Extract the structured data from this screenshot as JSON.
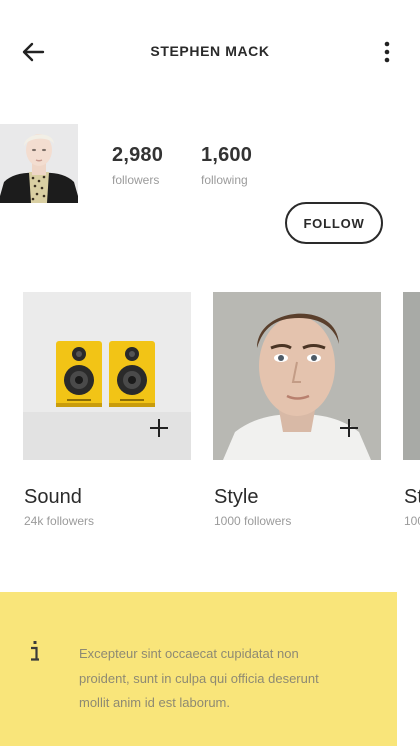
{
  "header": {
    "title": "STEPHEN MACK",
    "back_icon": "arrow-left-icon",
    "menu_icon": "more-vertical-icon"
  },
  "profile": {
    "followers_count": "2,980",
    "followers_label": "followers",
    "following_count": "1,600",
    "following_label": "following",
    "follow_button": "FOLLOW"
  },
  "cards": [
    {
      "title": "Sound",
      "subtitle": "24k followers",
      "image": "yellow-speakers",
      "action_icon": "plus-icon"
    },
    {
      "title": "Style",
      "subtitle": "1000 followers",
      "image": "portrait",
      "action_icon": "plus-icon"
    },
    {
      "title": "St",
      "subtitle": "100"
    }
  ],
  "info_banner": {
    "icon": "info-icon",
    "text": "Excepteur sint occaecat cupidatat non proident, sunt in culpa qui officia deserunt mollit anim id est laborum.",
    "background": "#f9e57a"
  }
}
